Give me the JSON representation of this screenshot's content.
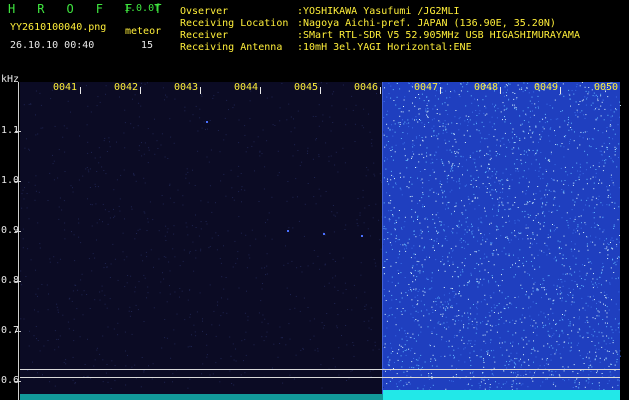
{
  "header": {
    "title": "H R O F F T",
    "version": "1.0.0f",
    "filename": "YY2610100040.png",
    "mode": "meteor",
    "datetime": "26.10.10 00:40",
    "count": "15"
  },
  "station_info": [
    {
      "label": "Ovserver",
      "value": ":YOSHIKAWA Yasufumi /JG2MLI"
    },
    {
      "label": "Receiving Location",
      "value": ":Nagoya Aichi-pref. JAPAN (136.90E, 35.20N)"
    },
    {
      "label": "Receiver",
      "value": ":SMart RTL-SDR V5 52.905MHz USB HIGASHIMURAYAMA"
    },
    {
      "label": "Receiving Antenna",
      "value": ":10mH 3el.YAGI Horizontal:ENE"
    }
  ],
  "axis": {
    "unit": "kHz",
    "y_ticks": [
      "1.1",
      "1.0",
      "0.9",
      "0.8",
      "0.7",
      "0.6"
    ],
    "time_labels": [
      "0041",
      "0042",
      "0043",
      "0044",
      "0045",
      "0046",
      "0047",
      "0048",
      "0049",
      "0050"
    ]
  },
  "colors": {
    "green": "#3fe63f",
    "yellow": "#ffef3a",
    "background": "#0b0b24",
    "noise_band": "#1f3fbf",
    "trace": "#22e8e8"
  }
}
